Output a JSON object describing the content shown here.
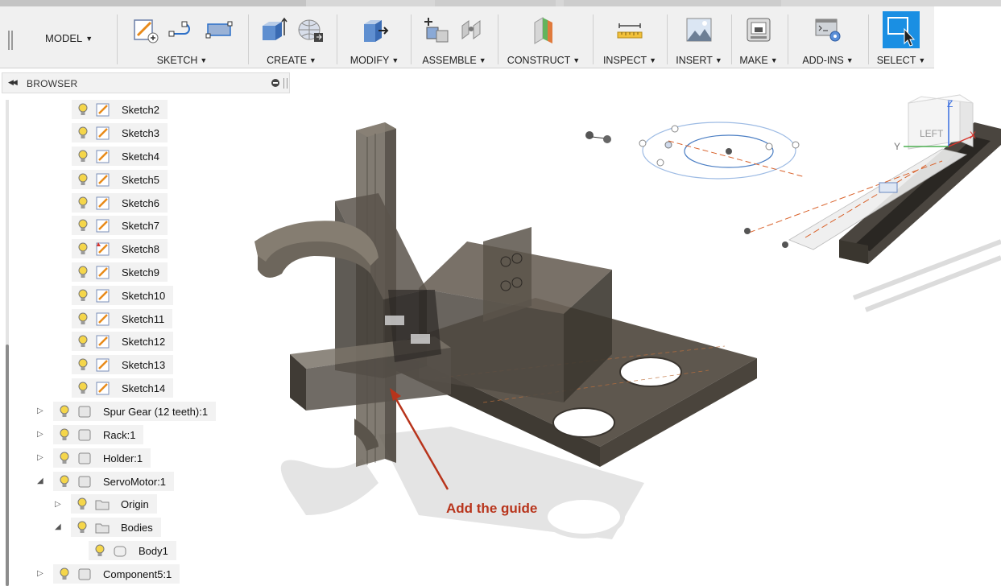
{
  "toolbar": {
    "model_label": "MODEL",
    "groups": [
      {
        "label": "SKETCH",
        "icons": [
          "create-sketch-icon",
          "arc-icon",
          "rectangle-icon"
        ]
      },
      {
        "label": "CREATE",
        "icons": [
          "extrude-icon",
          "form-icon"
        ]
      },
      {
        "label": "MODIFY",
        "icons": [
          "press-pull-icon"
        ]
      },
      {
        "label": "ASSEMBLE",
        "icons": [
          "new-component-icon",
          "joint-icon"
        ]
      },
      {
        "label": "CONSTRUCT",
        "icons": [
          "plane-icon"
        ]
      },
      {
        "label": "INSPECT",
        "icons": [
          "measure-icon"
        ]
      },
      {
        "label": "INSERT",
        "icons": [
          "insert-image-icon"
        ]
      },
      {
        "label": "MAKE",
        "icons": [
          "3d-print-icon"
        ]
      },
      {
        "label": "ADD-INS",
        "icons": [
          "scripts-icon"
        ]
      },
      {
        "label": "SELECT",
        "icons": [
          "select-icon"
        ]
      }
    ]
  },
  "browser": {
    "title": "BROWSER",
    "sketches": [
      "Sketch2",
      "Sketch3",
      "Sketch4",
      "Sketch5",
      "Sketch6",
      "Sketch7",
      "Sketch8",
      "Sketch9",
      "Sketch10",
      "Sketch11",
      "Sketch12",
      "Sketch13",
      "Sketch14"
    ],
    "components": [
      {
        "label": "Spur Gear (12 teeth):1",
        "expanded": false
      },
      {
        "label": "Rack:1",
        "expanded": false
      },
      {
        "label": "Holder:1",
        "expanded": false
      },
      {
        "label": "ServoMotor:1",
        "expanded": true
      }
    ],
    "servo_children": [
      {
        "label": "Origin",
        "expanded": false
      },
      {
        "label": "Bodies",
        "expanded": true
      }
    ],
    "body": "Body1",
    "last_component": "Component5:1"
  },
  "viewcube": {
    "face": "LEFT",
    "axis_x": "X",
    "axis_y": "Y",
    "axis_z": "Z"
  },
  "annotation": "Add the guide",
  "colors": {
    "annotation": "#b8341b",
    "select_accent": "#1a8fe3",
    "bulb": "#f5d64a"
  }
}
